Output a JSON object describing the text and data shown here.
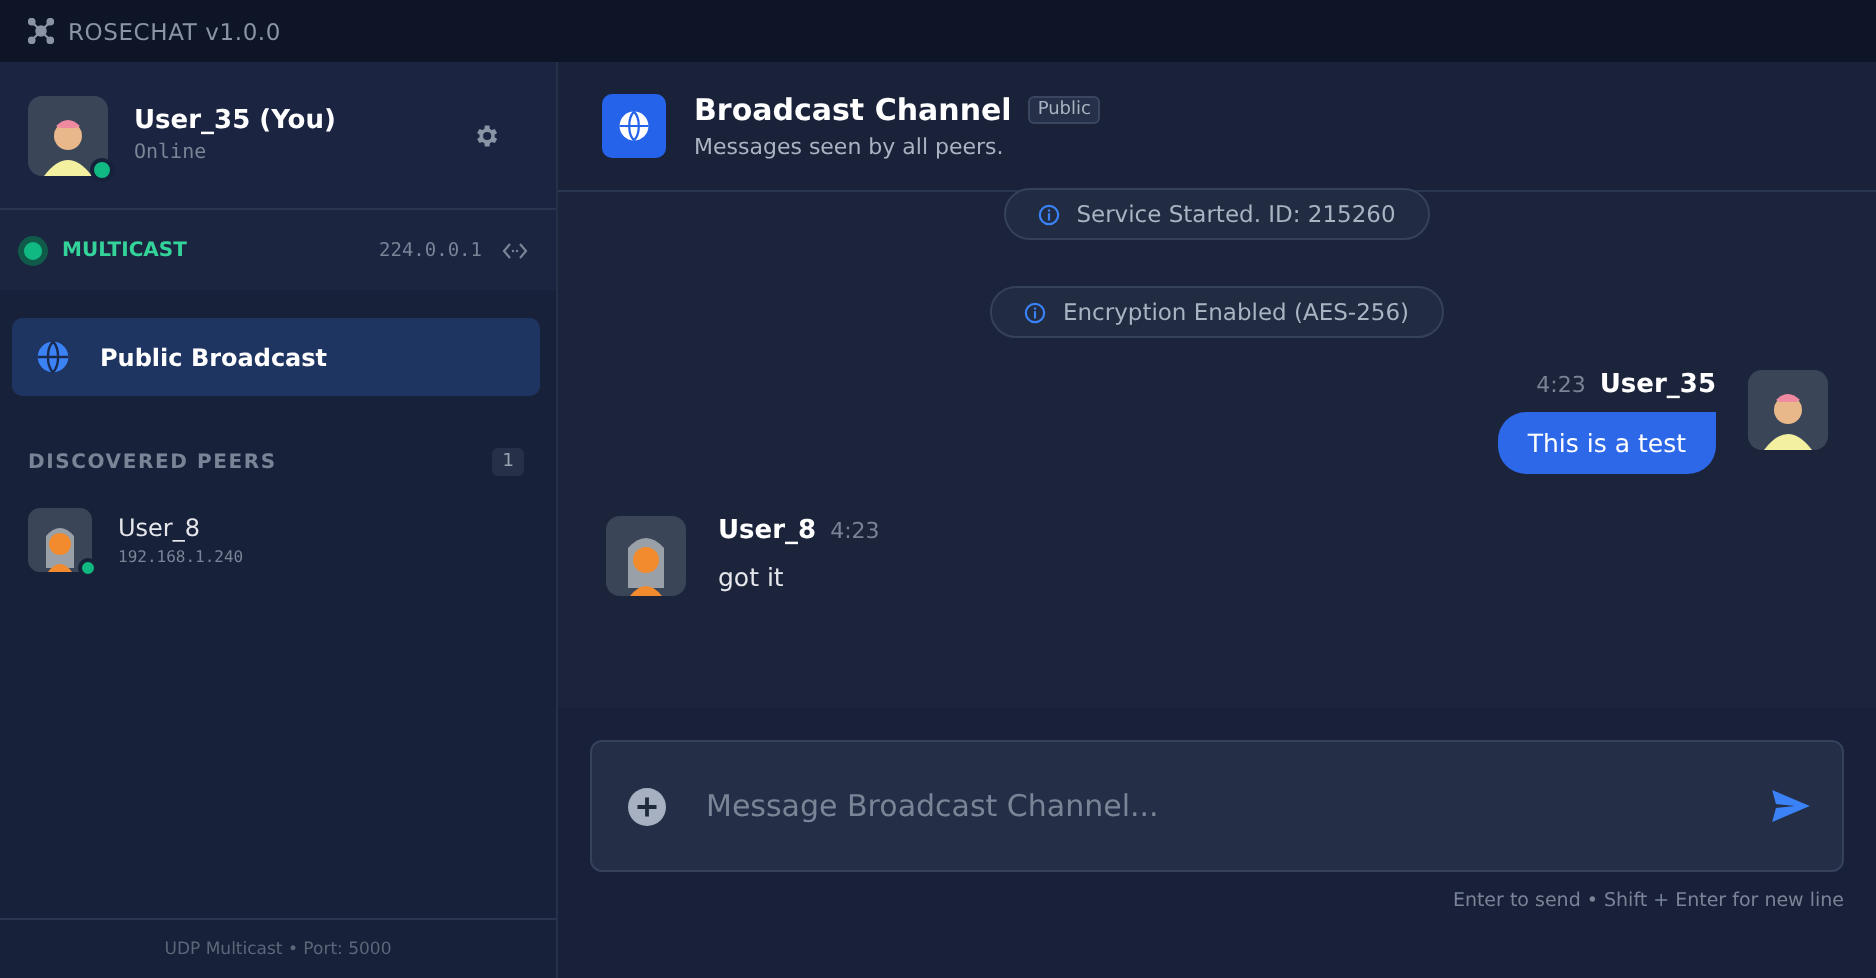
{
  "app_title": "ROSECHAT v1.0.0",
  "user": {
    "name": "User_35 (You)",
    "status": "Online",
    "online": true
  },
  "network": {
    "mode": "MULTICAST",
    "address": "224.0.0.1"
  },
  "channels": [
    {
      "label": "Public Broadcast",
      "selected": true
    }
  ],
  "peers_section": {
    "title": "DISCOVERED PEERS",
    "count": "1"
  },
  "peers": [
    {
      "name": "User_8",
      "address": "192.168.1.240",
      "online": true
    }
  ],
  "sidebar_footer": "UDP Multicast • Port: 5000",
  "channel_header": {
    "title": "Broadcast Channel",
    "badge": "Public",
    "subtitle": "Messages seen by all peers."
  },
  "messages": [
    {
      "kind": "system",
      "text": "Service Started. ID: 215260"
    },
    {
      "kind": "system",
      "text": "Encryption Enabled (AES-256)"
    },
    {
      "kind": "outgoing",
      "author": "User_35",
      "time": "4:23",
      "text": "This is a test"
    },
    {
      "kind": "incoming",
      "author": "User_8",
      "time": "4:23",
      "text": "got it"
    }
  ],
  "composer": {
    "placeholder": "Message Broadcast Channel...",
    "hint": "Enter to send • Shift + Enter for new line"
  }
}
